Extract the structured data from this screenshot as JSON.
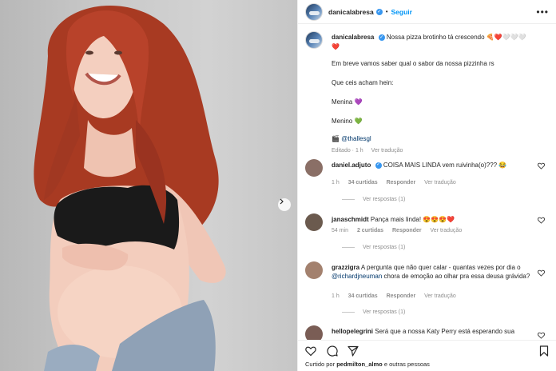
{
  "post": {
    "username": "danicalabresa",
    "follow_label": "Seguir",
    "separator": "•",
    "more_label": "•••"
  },
  "caption": {
    "username": "danicalabresa",
    "line1": "Nossa pizza brotinho tá crescendo 🍕❤️🤍🤍🤍",
    "line1b": "❤️",
    "line2": "Em breve vamos saber qual o sabor da nossa pizzinha rs",
    "line3": "Que ceis acham hein:",
    "line4": "Menina 💜",
    "line5": "Menino 💚",
    "credit_icon": "🎬",
    "credit": "@thallesgl",
    "meta_edited": "Editado · 1 h",
    "meta_translate": "Ver tradução"
  },
  "comments": [
    {
      "username": "daniel.adjuto",
      "verified": true,
      "text": "COISA MAIS LINDA vem ruivinha(o)??? 😂",
      "time": "1 h",
      "likes": "34 curtidas",
      "reply": "Responder",
      "translate": "Ver tradução",
      "replies": "Ver respostas (1)",
      "avatar_color": "#8a6f66"
    },
    {
      "username": "janaschmidt",
      "verified": false,
      "text": "Pança mais linda! 😍😍😍❤️",
      "time": "54 min",
      "likes": "2 curtidas",
      "reply": "Responder",
      "translate": "Ver tradução",
      "replies": "Ver respostas (1)",
      "avatar_color": "#6b5a4e"
    },
    {
      "username": "grazzigra",
      "verified": false,
      "text_before": "A pergunta que não quer calar - quantas vezes por dia o",
      "mention": "@richardjneuman",
      "text_after": "chora de emoção ao olhar pra essa deusa grávida?",
      "time": "1 h",
      "likes": "34 curtidas",
      "reply": "Responder",
      "translate": "Ver tradução",
      "replies": "Ver respostas (1)",
      "avatar_color": "#a3816e"
    },
    {
      "username": "hellopelegrini",
      "verified": false,
      "text": "Será que a nossa Katy Perry está esperando sua",
      "avatar_color": "#7a5d55"
    }
  ],
  "footer": {
    "likes_prefix": "Curtido por",
    "likes_user": "pedmilton_almo",
    "likes_suffix": "e outras pessoas"
  },
  "icons": {
    "verified": "verified-badge-icon",
    "heart": "heart-icon",
    "like": "like-icon",
    "comment": "comment-icon",
    "share": "share-icon",
    "save": "bookmark-icon",
    "next": "chevron-right-icon"
  },
  "colors": {
    "accent": "#0095f6",
    "verified": "#3897f0",
    "meta": "#8e8e8e",
    "hair": "#b8422a"
  }
}
